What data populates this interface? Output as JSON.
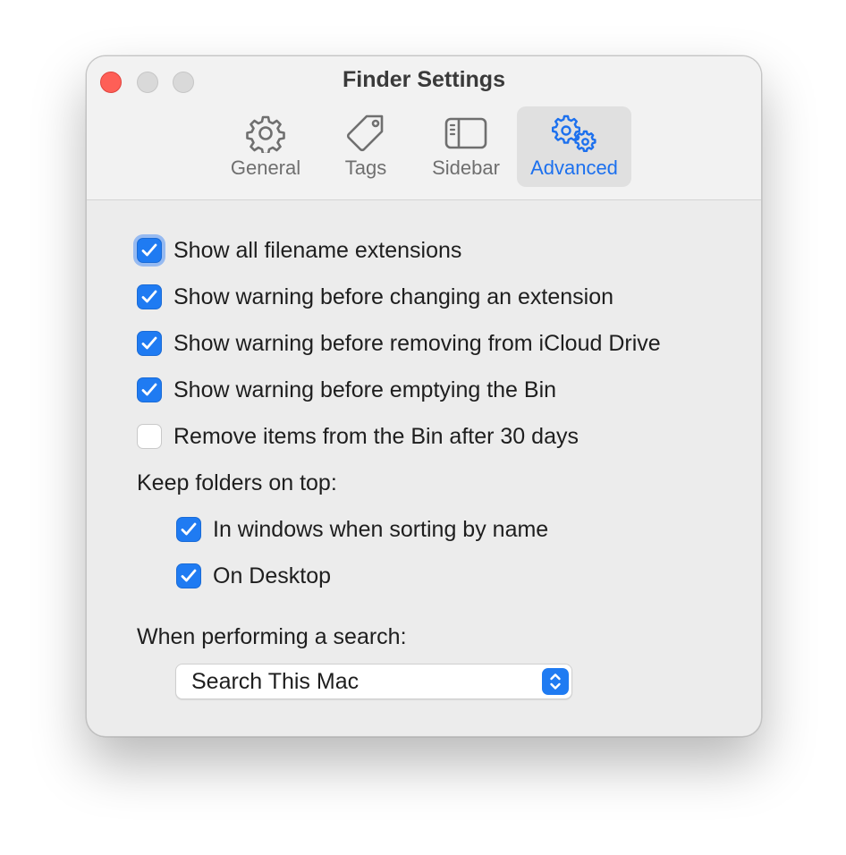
{
  "window": {
    "title": "Finder Settings"
  },
  "tabs": [
    {
      "label": "General",
      "icon": "gear-icon",
      "active": false
    },
    {
      "label": "Tags",
      "icon": "tag-icon",
      "active": false
    },
    {
      "label": "Sidebar",
      "icon": "sidebar-icon",
      "active": false
    },
    {
      "label": "Advanced",
      "icon": "gears-icon",
      "active": true
    }
  ],
  "options": [
    {
      "label": "Show all filename extensions",
      "checked": true
    },
    {
      "label": "Show warning before changing an extension",
      "checked": true
    },
    {
      "label": "Show warning before removing from iCloud Drive",
      "checked": true
    },
    {
      "label": "Show warning before emptying the Bin",
      "checked": true
    },
    {
      "label": "Remove items from the Bin after 30 days",
      "checked": false
    }
  ],
  "keep_folders": {
    "label": "Keep folders on top:",
    "options": [
      {
        "label": "In windows when sorting by name",
        "checked": true
      },
      {
        "label": "On Desktop",
        "checked": true
      }
    ]
  },
  "search": {
    "label": "When performing a search:",
    "selected": "Search This Mac"
  },
  "colors": {
    "accent": "#1f7bf2",
    "annotation": "#e8141c",
    "close": "#fe5f57"
  }
}
